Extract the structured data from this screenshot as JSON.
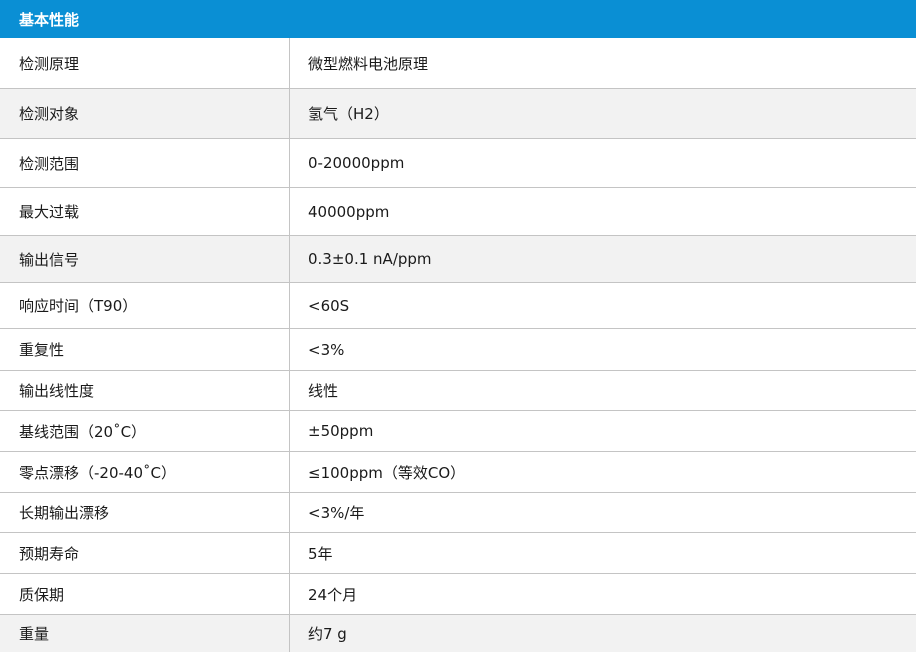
{
  "header": {
    "title": "基本性能"
  },
  "rows": [
    {
      "label": "检测原理",
      "value": "微型燃料电池原理"
    },
    {
      "label": "检测对象",
      "value": "氢气（H2）"
    },
    {
      "label": "检测范围",
      "value": "0-20000ppm"
    },
    {
      "label": "最大过载",
      "value": "40000ppm"
    },
    {
      "label": "输出信号",
      "value": "0.3±0.1 nA/ppm"
    },
    {
      "label": "响应时间（T90）",
      "value": "<60S"
    },
    {
      "label": "重复性",
      "value": "<3%"
    },
    {
      "label": "输出线性度",
      "value": "线性"
    },
    {
      "label": "基线范围（20˚C）",
      "value": "±50ppm"
    },
    {
      "label": "零点漂移（-20-40˚C）",
      "value": "≤100ppm（等效CO）"
    },
    {
      "label": "长期输出漂移",
      "value": "<3%/年"
    },
    {
      "label": "预期寿命",
      "value": "5年"
    },
    {
      "label": "质保期",
      "value": "24个月"
    },
    {
      "label": "重量",
      "value": "约7 g"
    }
  ]
}
